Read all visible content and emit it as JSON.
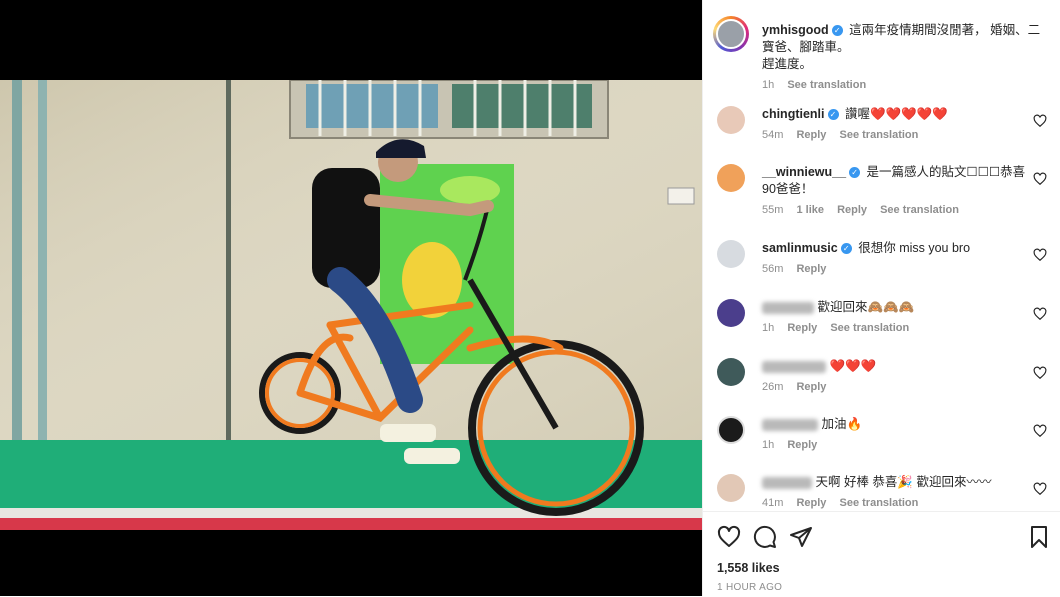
{
  "post": {
    "author": "ymhisgood",
    "caption_line1": "這兩年疫情期間沒閒著， 婚姻、二寶爸、腳踏車。",
    "caption_line2": "趕進度。",
    "time": "1h",
    "see_translation": "See translation"
  },
  "comments": [
    {
      "user": "chingtienli",
      "verified": true,
      "text": "讚喔❤️❤️❤️❤️❤️",
      "time": "54m",
      "likes": "",
      "reply": "Reply",
      "translate": "See translation"
    },
    {
      "user": "__winniewu__",
      "verified": true,
      "text": "是一篇感人的貼文☐☐☐恭喜90爸爸！",
      "time": "55m",
      "likes": "1 like",
      "reply": "Reply",
      "translate": "See translation"
    },
    {
      "user": "samlinmusic",
      "verified": true,
      "text": "很想你 miss you bro",
      "time": "56m",
      "likes": "",
      "reply": "Reply",
      "translate": ""
    },
    {
      "user": "",
      "verified": false,
      "text": "歡迎回來🙈🙈🙈",
      "time": "1h",
      "likes": "",
      "reply": "Reply",
      "translate": "See translation"
    },
    {
      "user": "",
      "verified": false,
      "text": "❤️❤️❤️",
      "time": "26m",
      "likes": "",
      "reply": "Reply",
      "translate": ""
    },
    {
      "user": "",
      "verified": false,
      "text": "加油🔥",
      "time": "1h",
      "likes": "",
      "reply": "Reply",
      "translate": ""
    },
    {
      "user": "",
      "verified": false,
      "text": "天啊 好棒 恭喜🎉 歡迎回來〰〰",
      "time": "41m",
      "likes": "",
      "reply": "Reply",
      "translate": "See translation"
    }
  ],
  "footer": {
    "likes": "1,558 likes",
    "time": "1 HOUR AGO"
  },
  "icons": {
    "like": "heart-outline-icon",
    "comment": "comment-bubble-icon",
    "share": "paper-plane-icon",
    "save": "bookmark-icon"
  },
  "colors": {
    "verified": "#3897f0",
    "heart": "#ed4956",
    "meta_gray": "#8e8e8e"
  }
}
